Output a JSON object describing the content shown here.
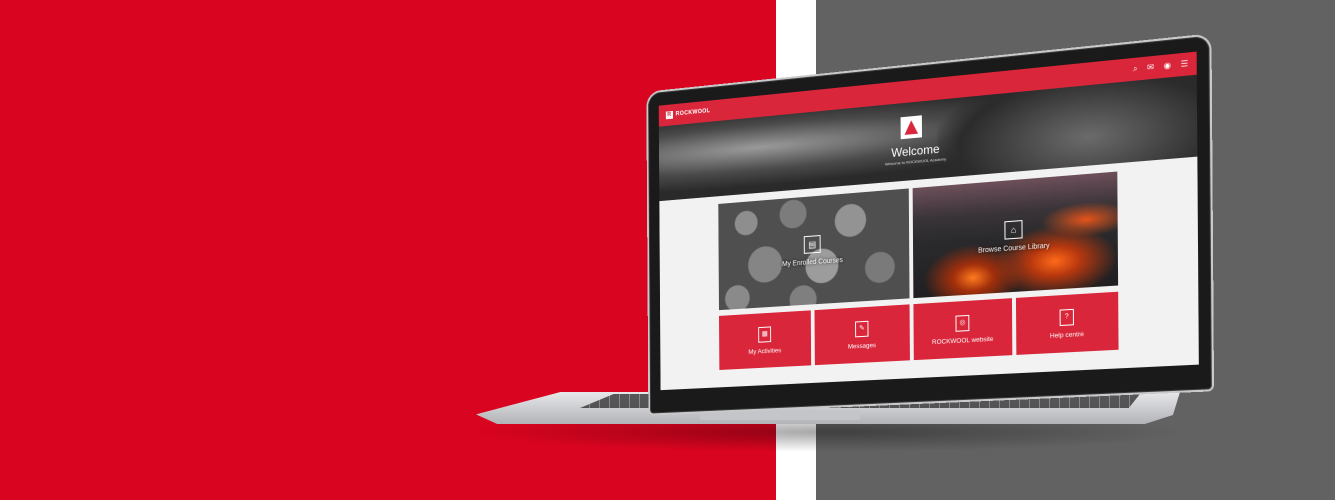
{
  "colors": {
    "brand_red": "#d9041f",
    "panel_gray": "#636263",
    "screen_red": "#d9263a"
  },
  "header": {
    "logo_text": "ROCKWOOL",
    "icons": [
      "search-icon",
      "notification-icon",
      "user-icon",
      "menu-icon"
    ]
  },
  "hero": {
    "title": "Welcome",
    "subtitle": "Welcome to ROCKWOOL Academy"
  },
  "tiles": {
    "enrolled": {
      "label": "My Enrolled Courses",
      "icon": "course-icon"
    },
    "library": {
      "label": "Browse Course Library",
      "icon": "library-icon"
    },
    "activities": {
      "label": "My Activities",
      "icon": "activities-icon"
    },
    "messages": {
      "label": "Messages",
      "icon": "messages-icon"
    },
    "website": {
      "label": "ROCKWOOL website",
      "icon": "globe-icon"
    },
    "help": {
      "label": "Help centre",
      "icon": "help-icon"
    }
  }
}
